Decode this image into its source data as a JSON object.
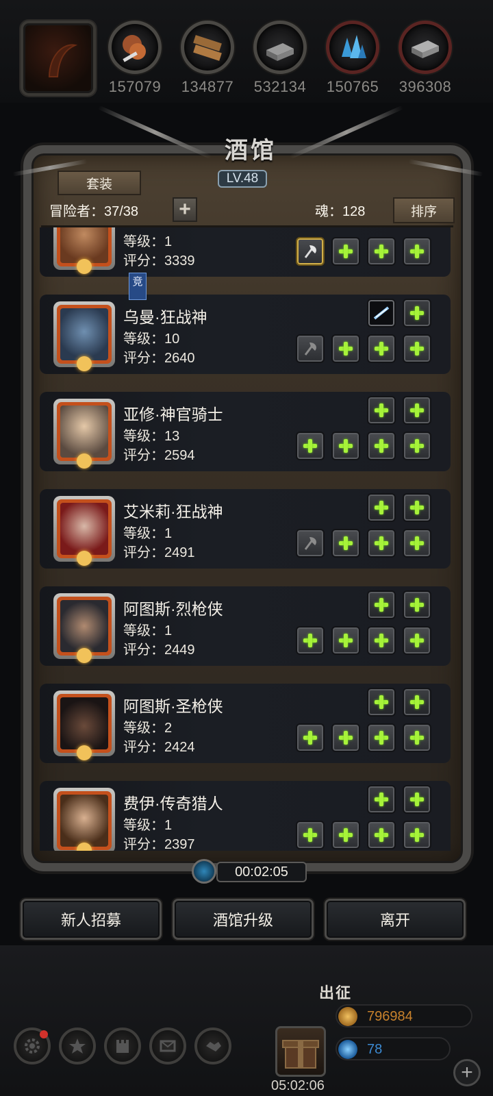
{
  "resources": [
    {
      "icon": "meat-icon",
      "value": "157079"
    },
    {
      "icon": "wood-icon",
      "value": "134877"
    },
    {
      "icon": "iron-icon",
      "value": "532134"
    },
    {
      "icon": "crystal-icon",
      "value": "150765"
    },
    {
      "icon": "steel-icon",
      "value": "396308"
    }
  ],
  "tavern": {
    "title": "酒馆",
    "level": "LV.48",
    "suit_button": "套装",
    "adventurers_label": "冒险者：37/38",
    "soul_label": "魂：128",
    "sort_button": "排序"
  },
  "heroes": [
    {
      "name": "",
      "level": "等级：1",
      "score": "评分：3339",
      "badge": "竞"
    },
    {
      "name": "乌曼·狂战神",
      "level": "等级：10",
      "score": "评分：2640"
    },
    {
      "name": "亚修·神官骑士",
      "level": "等级：13",
      "score": "评分：2594"
    },
    {
      "name": "艾米莉·狂战神",
      "level": "等级：1",
      "score": "评分：2491"
    },
    {
      "name": "阿图斯·烈枪侠",
      "level": "等级：1",
      "score": "评分：2449"
    },
    {
      "name": "阿图斯·圣枪侠",
      "level": "等级：2",
      "score": "评分：2424"
    },
    {
      "name": "费伊·传奇猎人",
      "level": "等级：1",
      "score": "评分：2397"
    }
  ],
  "timer": "00:02:05",
  "actions": {
    "recruit": "新人招募",
    "upgrade": "酒馆升级",
    "leave": "离开"
  },
  "bottom": {
    "depart": "出征",
    "gift_timer": "05:02:06",
    "gold": "796984",
    "gems": "78"
  },
  "colors": {
    "accent_green": "#a7f23a",
    "gold_text": "#c8822c",
    "gem_text": "#3c8ad2"
  }
}
